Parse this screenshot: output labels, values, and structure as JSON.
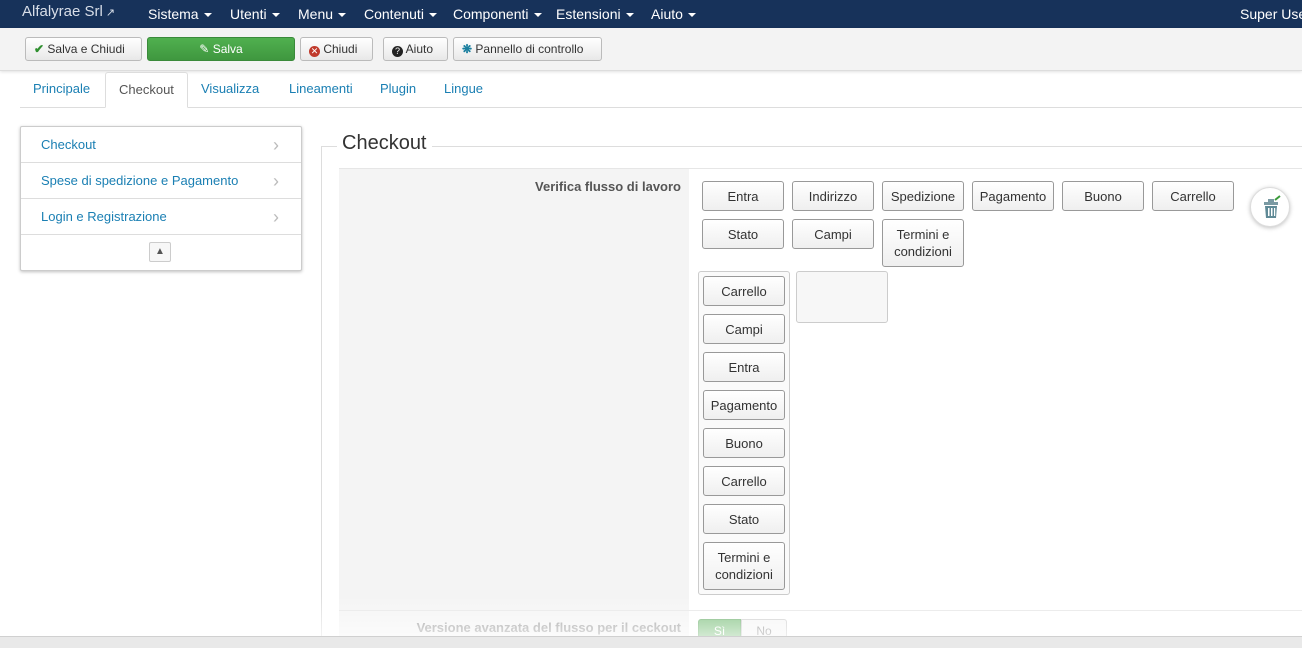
{
  "navbar": {
    "brand": "Alfalyrae Srl",
    "brand_icon": "external-link-icon",
    "menu": [
      "Sistema",
      "Utenti",
      "Menu",
      "Contenuti",
      "Componenti",
      "Estensioni",
      "Aiuto"
    ],
    "user": "Super User",
    "background": "#17325a"
  },
  "toolbar": {
    "save_close": "Salva e Chiudi",
    "save": "Salva",
    "close": "Chiudi",
    "help": "Aiuto",
    "control_panel": "Pannello di controllo",
    "accent": "#46a546"
  },
  "tabs": [
    "Principale",
    "Checkout",
    "Visualizza",
    "Lineamenti",
    "Plugin",
    "Lingue"
  ],
  "active_tab": "Checkout",
  "sidenav": {
    "items": [
      "Checkout",
      "Spese di spedizione e Pagamento",
      "Login e Registrazione"
    ],
    "footer_icon": "scroll-up-icon"
  },
  "section": {
    "legend": "Checkout",
    "workflow_label": "Verifica flusso di lavoro",
    "available_steps": [
      "Entra",
      "Indirizzo",
      "Spedizione",
      "Pagamento",
      "Buono",
      "Carrello",
      "Stato",
      "Campi",
      "Termini e condizioni"
    ],
    "ordered_steps": [
      "Carrello",
      "Campi",
      "Entra",
      "Pagamento",
      "Buono",
      "Carrello",
      "Stato",
      "Termini e condizioni"
    ],
    "advanced_label": "Versione avanzata del flusso per il ceckout",
    "toggle_yes": "Sì",
    "toggle_no": "No"
  }
}
